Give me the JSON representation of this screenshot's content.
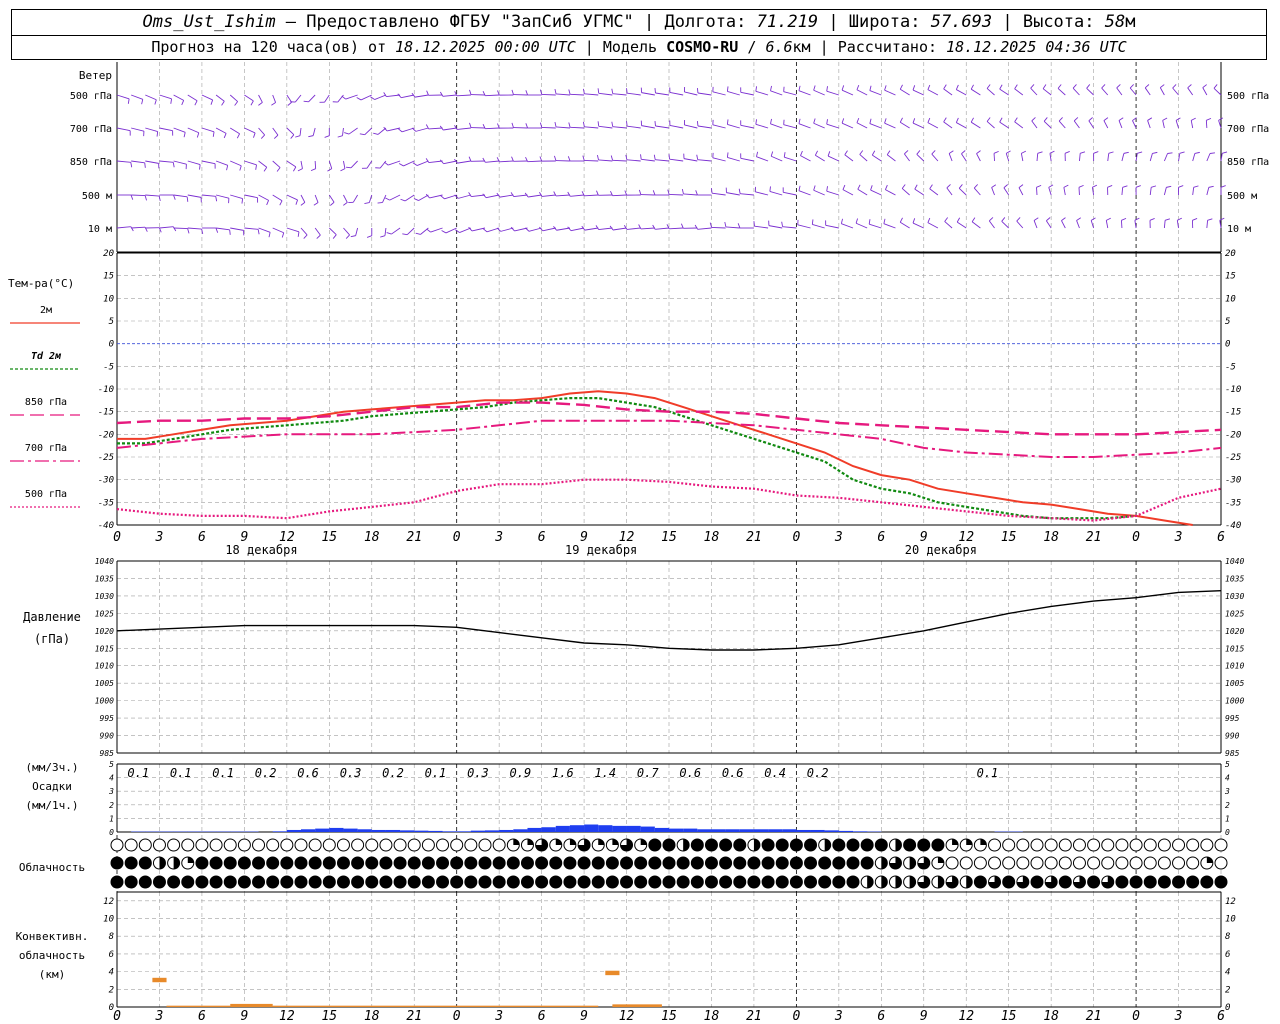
{
  "header": {
    "station": "Oms_Ust_Ishim",
    "provided_by": "Предоставлено ФГБУ \"ЗапСиб УГМС\"",
    "lon_label": "Долгота:",
    "lon_value": "71.219",
    "lat_label": "Широта:",
    "lat_value": "57.693",
    "alt_label": "Высота:",
    "alt_value": "58",
    "alt_unit": "м",
    "forecast_prefix": "Прогноз на 120 часа(ов) от",
    "forecast_time": "18.12.2025 00:00 UTC",
    "model_label": "Модель",
    "model_name": "COSMO-RU",
    "model_res": "6.6",
    "model_res_unit": "км",
    "calc_label": "Рассчитано:",
    "calc_time": "18.12.2025 04:36 UTC"
  },
  "colors": {
    "wind": "#7a2fd0",
    "t2m": "#f03c28",
    "td2m": "#118a11",
    "t850": "#e6197e",
    "t700": "#e6197e",
    "t500": "#e6197e",
    "zero_line": "#3b4fd8",
    "pressure": "#000000",
    "precip": "#1f3ef0",
    "convective": "#e88a2a",
    "grid": "#a0a0a0"
  },
  "x_tick_labels": [
    "0",
    "3",
    "6",
    "9",
    "12",
    "15",
    "18",
    "21",
    "0",
    "3",
    "6",
    "9",
    "12",
    "15",
    "18",
    "21",
    "0",
    "3",
    "6",
    "9",
    "12",
    "15",
    "18",
    "21",
    "0",
    "3",
    "6"
  ],
  "day_labels": [
    "18 декабря",
    "19 декабря",
    "20 декабря"
  ],
  "wind": {
    "title": "Ветер",
    "levels": [
      "500 гПа",
      "700 гПа",
      "850 гПа",
      "500 м",
      "10  м"
    ]
  },
  "temperature": {
    "title": "Тем-ра(°C)",
    "legend": [
      {
        "key": "t2m",
        "label": "2м"
      },
      {
        "key": "td2m",
        "label": "Td 2м"
      },
      {
        "key": "t850",
        "label": "850 гПа"
      },
      {
        "key": "t700",
        "label": "700 гПа"
      },
      {
        "key": "t500",
        "label": "500 гПа"
      }
    ],
    "ticks": [
      "20",
      "15",
      "10",
      "5",
      "0",
      "-5",
      "-10",
      "-15",
      "-20",
      "-25",
      "-30",
      "-35",
      "-40"
    ]
  },
  "pressure": {
    "title": "Давление",
    "unit": "(гПа)",
    "ticks": [
      "1040",
      "1035",
      "1030",
      "1025",
      "1020",
      "1015",
      "1010",
      "1005",
      "1000",
      "995",
      "990",
      "985"
    ]
  },
  "precip": {
    "unit_3h": "(мм/3ч.)",
    "title": "Осадки",
    "unit_1h": "(мм/1ч.)",
    "ticks": [
      "5",
      "4",
      "3",
      "2",
      "1",
      "0"
    ],
    "labels": [
      {
        "h": 3,
        "v": "0.1"
      },
      {
        "h": 6,
        "v": "0.1"
      },
      {
        "h": 9,
        "v": "0.1"
      },
      {
        "h": 12,
        "v": "0.2"
      },
      {
        "h": 15,
        "v": "0.6"
      },
      {
        "h": 18,
        "v": "0.3"
      },
      {
        "h": 21,
        "v": "0.2"
      },
      {
        "h": 24,
        "v": "0.1"
      },
      {
        "h": 27,
        "v": "0.3"
      },
      {
        "h": 30,
        "v": "0.9"
      },
      {
        "h": 33,
        "v": "1.6"
      },
      {
        "h": 36,
        "v": "1.4"
      },
      {
        "h": 39,
        "v": "0.7"
      },
      {
        "h": 42,
        "v": "0.6"
      },
      {
        "h": 45,
        "v": "0.6"
      },
      {
        "h": 48,
        "v": "0.4"
      },
      {
        "h": 51,
        "v": "0.2"
      },
      {
        "h": 63,
        "v": "0.1"
      }
    ]
  },
  "cloud": {
    "title": "Облачность"
  },
  "convective": {
    "title1": "Конвективн.",
    "title2": "облачность",
    "unit": "(км)",
    "ticks": [
      "12",
      "10",
      "8",
      "6",
      "4",
      "2",
      "0"
    ]
  },
  "chart_data": [
    {
      "type": "line",
      "name": "temperature",
      "x_unit": "hours from 18.12.2025 00:00 UTC",
      "ylim": [
        -40,
        20
      ],
      "series": [
        {
          "key": "t2m",
          "name": "2м",
          "x": [
            0,
            2,
            4,
            6,
            8,
            10,
            12,
            14,
            16,
            18,
            20,
            22,
            24,
            26,
            28,
            30,
            32,
            34,
            36,
            38,
            40,
            42,
            44,
            46,
            48,
            50,
            52,
            54,
            56,
            58,
            60,
            62,
            64,
            66,
            68,
            70,
            72,
            74,
            76
          ],
          "values": [
            -21,
            -21,
            -20,
            -19,
            -18,
            -17.5,
            -17,
            -16,
            -15,
            -14.5,
            -14,
            -13.5,
            -13,
            -12.5,
            -12.5,
            -12,
            -11,
            -10.5,
            -11,
            -12,
            -14,
            -16,
            -18,
            -20,
            -22,
            -24,
            -27,
            -29,
            -30,
            -32,
            -33,
            -34,
            -35,
            -35.5,
            -36.5,
            -37.5,
            -38,
            -39,
            -40
          ]
        },
        {
          "key": "td2m",
          "name": "Td 2м",
          "x": [
            0,
            2,
            4,
            6,
            8,
            10,
            12,
            14,
            16,
            18,
            20,
            22,
            24,
            26,
            28,
            30,
            32,
            34,
            36,
            38,
            40,
            42,
            44,
            46,
            48,
            50,
            52,
            54,
            56,
            58,
            60,
            62,
            64,
            66,
            68,
            70,
            72
          ],
          "values": [
            -22,
            -22,
            -21,
            -20,
            -19,
            -18.5,
            -18,
            -17.5,
            -17,
            -16,
            -15.5,
            -15,
            -14.5,
            -14,
            -13,
            -12.5,
            -12,
            -12,
            -13,
            -14,
            -16,
            -18,
            -20,
            -22,
            -24,
            -26,
            -30,
            -32,
            -33,
            -35,
            -36,
            -37,
            -38,
            -38.5,
            -38.5,
            -38.5,
            -38
          ]
        },
        {
          "key": "t850",
          "name": "850 гПа",
          "x": [
            0,
            3,
            6,
            9,
            12,
            15,
            18,
            21,
            24,
            27,
            30,
            33,
            36,
            39,
            42,
            45,
            48,
            51,
            54,
            57,
            60,
            63,
            66,
            69,
            72,
            75,
            78
          ],
          "values": [
            -17.5,
            -17,
            -17,
            -16.5,
            -16.5,
            -16,
            -15,
            -14,
            -14,
            -13,
            -13,
            -13.5,
            -14.5,
            -15,
            -15,
            -15.5,
            -16.5,
            -17.5,
            -18,
            -18.5,
            -19,
            -19.5,
            -20,
            -20,
            -20,
            -19.5,
            -19
          ]
        },
        {
          "key": "t700",
          "name": "700 гПа",
          "x": [
            0,
            3,
            6,
            9,
            12,
            15,
            18,
            21,
            24,
            27,
            30,
            33,
            36,
            39,
            42,
            45,
            48,
            51,
            54,
            57,
            60,
            63,
            66,
            69,
            72,
            75,
            78
          ],
          "values": [
            -23,
            -22,
            -21,
            -20.5,
            -20,
            -20,
            -20,
            -19.5,
            -19,
            -18,
            -17,
            -17,
            -17,
            -17,
            -17.5,
            -18,
            -19,
            -20,
            -21,
            -23,
            -24,
            -24.5,
            -25,
            -25,
            -24.5,
            -24,
            -23
          ]
        },
        {
          "key": "t500",
          "name": "500 гПа",
          "x": [
            0,
            3,
            6,
            9,
            12,
            15,
            18,
            21,
            24,
            27,
            30,
            33,
            36,
            39,
            42,
            45,
            48,
            51,
            54,
            57,
            60,
            63,
            66,
            69,
            72,
            75,
            78
          ],
          "values": [
            -36.5,
            -37.5,
            -38,
            -38,
            -38.5,
            -37,
            -36,
            -35,
            -32.5,
            -31,
            -31,
            -30,
            -30,
            -30.5,
            -31.5,
            -32,
            -33.5,
            -34,
            -35,
            -36,
            -37,
            -38,
            -38.5,
            -39,
            -38,
            -34,
            -32
          ]
        }
      ]
    },
    {
      "type": "line",
      "name": "pressure",
      "ylim": [
        985,
        1040
      ],
      "series": [
        {
          "key": "pressure",
          "name": "Давление",
          "x": [
            0,
            3,
            6,
            9,
            12,
            15,
            18,
            21,
            24,
            27,
            30,
            33,
            36,
            39,
            42,
            45,
            48,
            51,
            54,
            57,
            60,
            63,
            66,
            69,
            72,
            75,
            78
          ],
          "values": [
            1020,
            1020.5,
            1021,
            1021.5,
            1021.5,
            1021.5,
            1021.5,
            1021.5,
            1021,
            1019.5,
            1018,
            1016.5,
            1016,
            1015,
            1014.5,
            1014.5,
            1015,
            1016,
            1018,
            1020,
            1022.5,
            1025,
            1027,
            1028.5,
            1029.5,
            1031,
            1031.5
          ]
        }
      ]
    },
    {
      "type": "bar",
      "name": "precipitation",
      "ylim": [
        0,
        5
      ],
      "x": [
        0,
        1,
        2,
        3,
        4,
        5,
        6,
        7,
        8,
        9,
        10,
        11,
        12,
        13,
        14,
        15,
        16,
        17,
        18,
        19,
        20,
        21,
        22,
        23,
        24,
        25,
        26,
        27,
        28,
        29,
        30,
        31,
        32,
        33,
        34,
        35,
        36,
        37,
        38,
        39,
        40,
        41,
        42,
        43,
        44,
        45,
        46,
        47,
        48,
        49,
        50,
        51,
        52,
        53,
        54,
        55,
        56,
        57,
        58,
        59,
        60,
        61,
        62,
        63,
        64,
        65,
        66,
        67,
        68,
        69,
        70,
        71,
        72,
        73,
        74,
        75,
        76,
        77
      ],
      "values": [
        0,
        0.03,
        0.03,
        0.03,
        0.03,
        0.03,
        0.03,
        0.03,
        0.03,
        0.03,
        0,
        0.05,
        0.15,
        0.2,
        0.25,
        0.3,
        0.25,
        0.2,
        0.15,
        0.15,
        0.12,
        0.1,
        0.08,
        0.05,
        0.05,
        0.1,
        0.12,
        0.15,
        0.2,
        0.3,
        0.35,
        0.45,
        0.5,
        0.55,
        0.5,
        0.45,
        0.45,
        0.4,
        0.3,
        0.25,
        0.25,
        0.2,
        0.2,
        0.2,
        0.2,
        0.2,
        0.2,
        0.2,
        0.15,
        0.15,
        0.12,
        0.08,
        0.05,
        0.03,
        0,
        0,
        0,
        0,
        0,
        0,
        0,
        0,
        0.03,
        0.03,
        0,
        0,
        0,
        0,
        0,
        0,
        0,
        0,
        0,
        0,
        0,
        0,
        0,
        0
      ]
    },
    {
      "type": "bar",
      "name": "convective_cloud",
      "ylim": [
        0,
        13
      ],
      "segments": [
        {
          "x0": 2.5,
          "x1": 3.5,
          "bottom": 2.8,
          "top": 3.3
        },
        {
          "x0": 34.5,
          "x1": 35.5,
          "bottom": 3.6,
          "top": 4.1
        },
        {
          "x0": 3.5,
          "x1": 8,
          "bottom": 0,
          "top": 0.15
        },
        {
          "x0": 8,
          "x1": 11,
          "bottom": 0,
          "top": 0.35
        },
        {
          "x0": 11,
          "x1": 34,
          "bottom": 0,
          "top": 0.15
        },
        {
          "x0": 35,
          "x1": 38.5,
          "bottom": 0,
          "top": 0.3
        }
      ]
    }
  ]
}
